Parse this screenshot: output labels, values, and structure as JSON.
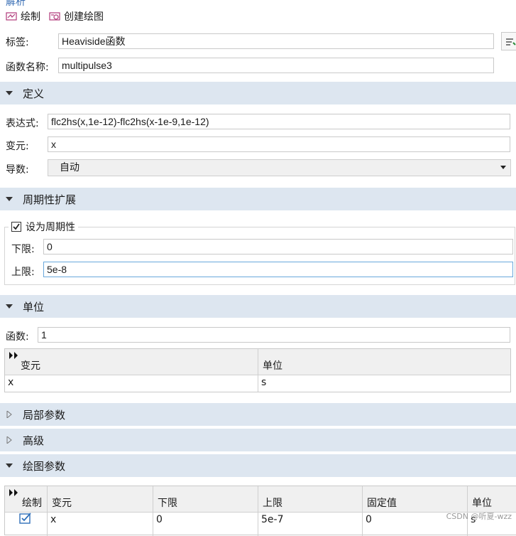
{
  "header": {
    "title_partial": "解析",
    "plot_label": "绘制",
    "create_plot_label": "创建绘图"
  },
  "general": {
    "label_caption": "标签:",
    "label_value": "Heaviside函数",
    "func_name_caption": "函数名称:",
    "func_name_value": "multipulse3"
  },
  "definition": {
    "section_title": "定义",
    "expr_caption": "表达式:",
    "expr_value": "flc2hs(x,1e-12)-flc2hs(x-1e-9,1e-12)",
    "args_caption": "变元:",
    "args_value": "x",
    "deriv_caption": "导数:",
    "deriv_value": "自动"
  },
  "periodic": {
    "section_title": "周期性扩展",
    "checkbox_label": "设为周期性",
    "checked": true,
    "lower_caption": "下限:",
    "lower_value": "0",
    "upper_caption": "上限:",
    "upper_value": "5e-8"
  },
  "units": {
    "section_title": "单位",
    "function_caption": "函数:",
    "function_value": "1",
    "table_headers": [
      "变元",
      "单位"
    ],
    "table_rows": [
      [
        "x",
        "s"
      ]
    ]
  },
  "local_params": {
    "section_title": "局部参数"
  },
  "advanced": {
    "section_title": "高级"
  },
  "plot_params": {
    "section_title": "绘图参数",
    "headers": [
      "绘制",
      "变元",
      "下限",
      "上限",
      "固定值",
      "单位"
    ],
    "row": {
      "checked": true,
      "arg": "x",
      "lower": "0",
      "upper": "5e-7",
      "fixed": "0",
      "unit": "s"
    }
  },
  "watermark": "CSDN @听夏-wzz",
  "colors": {
    "section_bg": "#dde6f0",
    "focus_border": "#69a8dc",
    "check_blue": "#2f6fb8"
  }
}
